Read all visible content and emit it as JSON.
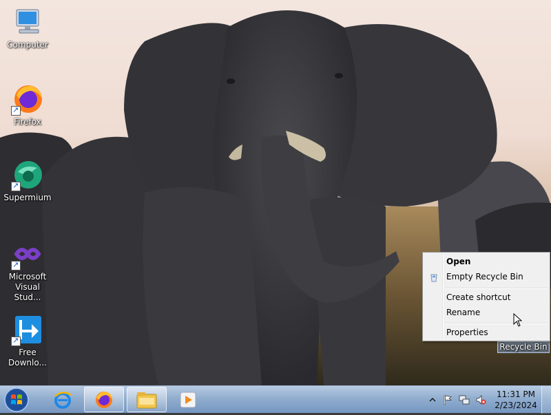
{
  "desktop": {
    "icons": [
      {
        "label": "Computer",
        "icon": "computer-icon"
      },
      {
        "label": "Firefox",
        "icon": "firefox-icon"
      },
      {
        "label": "Supermium",
        "icon": "supermium-icon"
      },
      {
        "label": "Microsoft Visual Stud...",
        "icon": "visual-studio-icon"
      },
      {
        "label": "Free Downlo...",
        "icon": "free-download-manager-icon"
      },
      {
        "label": "Recycle Bin",
        "icon": "recycle-bin-icon"
      }
    ]
  },
  "context_menu": {
    "items": [
      {
        "label": "Open",
        "bold": true
      },
      {
        "label": "Empty Recycle Bin",
        "icon": "recycle-bin-small-icon"
      },
      {
        "label": "Create shortcut"
      },
      {
        "label": "Rename"
      },
      {
        "label": "Properties"
      }
    ]
  },
  "taskbar": {
    "start_icon": "windows-start-icon",
    "buttons": [
      {
        "icon": "internet-explorer-icon"
      },
      {
        "icon": "firefox-icon"
      },
      {
        "icon": "file-explorer-icon"
      },
      {
        "icon": "media-player-icon"
      }
    ],
    "tray": {
      "icons": [
        "show-hidden-icons-chevron",
        "action-center-flag-icon",
        "network-icon",
        "volume-muted-icon"
      ]
    },
    "clock": {
      "time": "11:31 PM",
      "date": "2/23/2024"
    }
  },
  "colors": {
    "taskbar": "#9bb6d8",
    "menu_bg": "#f0f0f0"
  }
}
